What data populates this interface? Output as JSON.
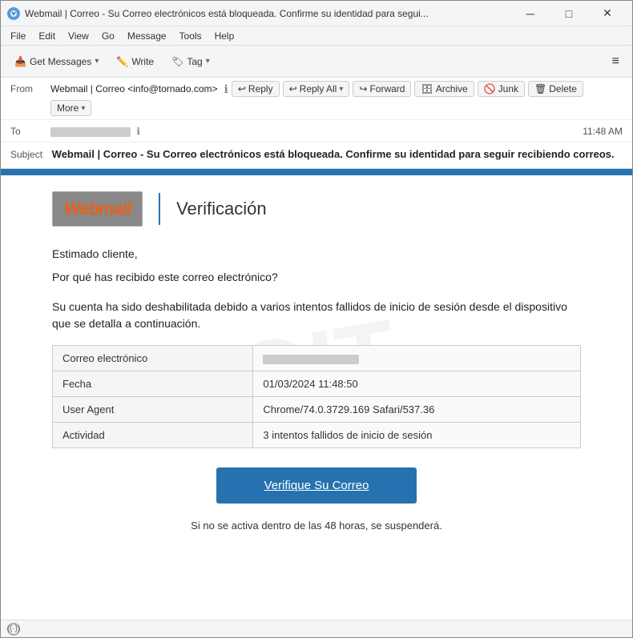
{
  "window": {
    "title": "Webmail | Correo - Su Correo electrónicos está bloqueada. Confirme su identidad para segui...",
    "title_short": "Webmail | Correo - Su Correo electrónicos"
  },
  "menu": {
    "items": [
      "File",
      "Edit",
      "View",
      "Go",
      "Message",
      "Tools",
      "Help"
    ]
  },
  "toolbar": {
    "get_messages": "Get Messages",
    "write": "Write",
    "tag": "Tag",
    "hamburger": "≡"
  },
  "email_header": {
    "from_label": "From",
    "from_value": "Webmail | Correo <info@tornado.com>",
    "reply_label": "Reply",
    "reply_all_label": "Reply All",
    "forward_label": "Forward",
    "archive_label": "Archive",
    "junk_label": "Junk",
    "delete_label": "Delete",
    "more_label": "More",
    "to_label": "To",
    "time": "11:48 AM",
    "subject_label": "Subject",
    "subject_text": "Webmail | Correo - Su Correo electrónicos está bloqueada. Confirme su identidad para seguir recibiendo correos."
  },
  "email_body": {
    "logo_text": "Webmail",
    "verification_title": "Verificación",
    "greeting": "Estimado cliente,",
    "why_line": "Por qué has recibido este correo electrónico?",
    "body_paragraph": "Su cuenta ha sido deshabilitada debido a varios intentos fallidos de inicio de sesión desde el dispositivo que se detalla a continuación.",
    "table": {
      "rows": [
        {
          "label": "Correo electrónico",
          "value": "redacted"
        },
        {
          "label": "Fecha",
          "value": "01/03/2024 11:48:50"
        },
        {
          "label": "User Agent",
          "value": "Chrome/74.0.3729.169 Safari/537.36"
        },
        {
          "label": "Actividad",
          "value": "3 intentos fallidos de inicio de sesión"
        }
      ]
    },
    "verify_btn": "Verifique Su Correo",
    "footer_text": "Si no se activa dentro de las 48 horas, se suspenderá."
  },
  "status_bar": {
    "icon": "((·))"
  },
  "colors": {
    "accent_blue": "#2672b0",
    "logo_orange": "#e8611a",
    "logo_bg": "#888888"
  }
}
